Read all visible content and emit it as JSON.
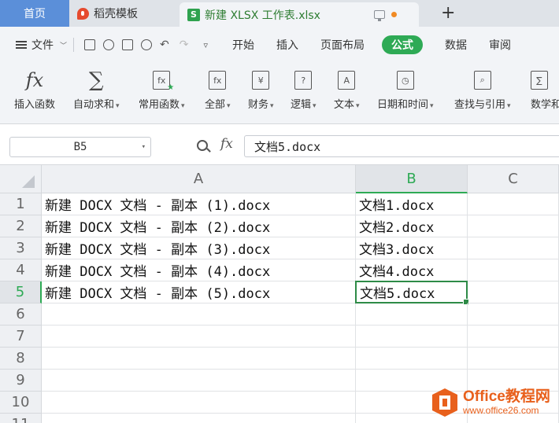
{
  "tabs": {
    "home": "首页",
    "docer": "稻壳模板",
    "file_icon": "S",
    "file": "新建 XLSX 工作表.xlsx",
    "new_tab": "+"
  },
  "menu": {
    "file": "文件",
    "items": [
      "开始",
      "插入",
      "页面布局",
      "公式",
      "数据",
      "审阅"
    ],
    "active": "公式"
  },
  "ribbon": {
    "buttons": [
      {
        "label": "插入函数",
        "icon": "fx-icon",
        "glyph": "fx"
      },
      {
        "label": "自动求和",
        "icon": "sigma-icon",
        "glyph": "∑",
        "dropdown": true
      },
      {
        "label": "常用函数",
        "icon": "common-function-icon",
        "glyph": "fx",
        "dropdown": true
      },
      {
        "label": "全部",
        "icon": "all-function-icon",
        "glyph": "fx",
        "dropdown": true
      },
      {
        "label": "财务",
        "icon": "finance-icon",
        "glyph": "¥",
        "dropdown": true
      },
      {
        "label": "逻辑",
        "icon": "logic-icon",
        "glyph": "?",
        "dropdown": true
      },
      {
        "label": "文本",
        "icon": "text-icon",
        "glyph": "A",
        "dropdown": true
      },
      {
        "label": "日期和时间",
        "icon": "datetime-icon",
        "glyph": "◷",
        "dropdown": true
      },
      {
        "label": "查找与引用",
        "icon": "lookup-icon",
        "glyph": "⌕",
        "dropdown": true
      },
      {
        "label": "数学和",
        "icon": "math-icon",
        "glyph": "∑",
        "dropdown": false
      }
    ]
  },
  "formula_bar": {
    "name_box": "B5",
    "fx": "fx",
    "value": "文档5.docx"
  },
  "sheet": {
    "columns": [
      "A",
      "B",
      "C"
    ],
    "selected_column": "B",
    "selected_row": "5",
    "rows": [
      {
        "num": "1",
        "a": "新建 DOCX 文档 - 副本 (1).docx",
        "b": "文档1.docx"
      },
      {
        "num": "2",
        "a": "新建 DOCX 文档 - 副本 (2).docx",
        "b": "文档2.docx"
      },
      {
        "num": "3",
        "a": "新建 DOCX 文档 - 副本 (3).docx",
        "b": "文档3.docx"
      },
      {
        "num": "4",
        "a": "新建 DOCX 文档 - 副本 (4).docx",
        "b": "文档4.docx"
      },
      {
        "num": "5",
        "a": "新建 DOCX 文档 - 副本 (5).docx",
        "b": "文档5.docx"
      },
      {
        "num": "6",
        "a": "",
        "b": ""
      },
      {
        "num": "7",
        "a": "",
        "b": ""
      },
      {
        "num": "8",
        "a": "",
        "b": ""
      },
      {
        "num": "9",
        "a": "",
        "b": ""
      },
      {
        "num": "10",
        "a": "",
        "b": ""
      },
      {
        "num": "11",
        "a": "",
        "b": ""
      }
    ]
  },
  "watermark": {
    "title": "Office教程网",
    "url": "www.office26.com"
  },
  "colors": {
    "accent_green": "#2eaa55",
    "home_blue": "#5b8fd9",
    "watermark_orange": "#e8601c"
  }
}
